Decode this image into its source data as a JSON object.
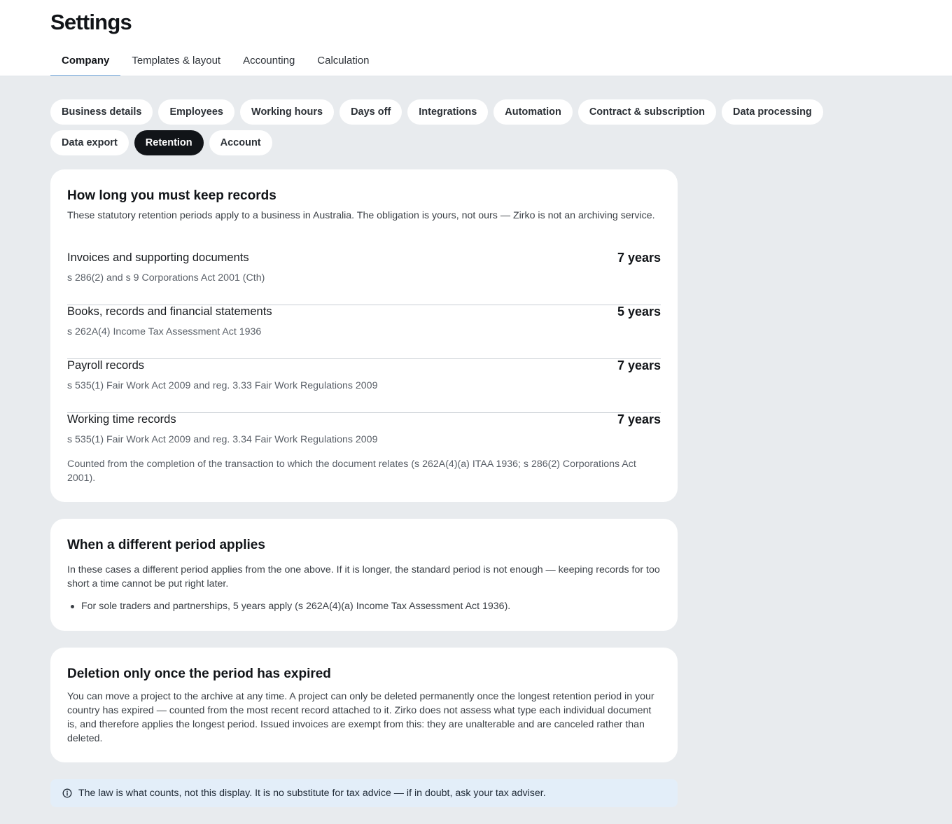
{
  "header": {
    "title": "Settings",
    "tabs": [
      {
        "label": "Company",
        "active": true
      },
      {
        "label": "Templates & layout",
        "active": false
      },
      {
        "label": "Accounting",
        "active": false
      },
      {
        "label": "Calculation",
        "active": false
      }
    ]
  },
  "subnav": {
    "chips": [
      {
        "label": "Business details",
        "active": false
      },
      {
        "label": "Employees",
        "active": false
      },
      {
        "label": "Working hours",
        "active": false
      },
      {
        "label": "Days off",
        "active": false
      },
      {
        "label": "Integrations",
        "active": false
      },
      {
        "label": "Automation",
        "active": false
      },
      {
        "label": "Contract & subscription",
        "active": false
      },
      {
        "label": "Data processing",
        "active": false
      },
      {
        "label": "Data export",
        "active": false
      },
      {
        "label": "Retention",
        "active": true
      },
      {
        "label": "Account",
        "active": false
      }
    ]
  },
  "retention": {
    "title": "How long you must keep records",
    "intro": "These statutory retention periods apply to a business in Australia. The obligation is yours, not ours — Zirko is not an archiving service.",
    "records": [
      {
        "label": "Invoices and supporting documents",
        "value": "7 years",
        "reference": "s 286(2) and s 9 Corporations Act 2001 (Cth)"
      },
      {
        "label": "Books, records and financial statements",
        "value": "5 years",
        "reference": "s 262A(4) Income Tax Assessment Act 1936"
      },
      {
        "label": "Payroll records",
        "value": "7 years",
        "reference": "s 535(1) Fair Work Act 2009 and reg. 3.33 Fair Work Regulations 2009"
      },
      {
        "label": "Working time records",
        "value": "7 years",
        "reference": "s 535(1) Fair Work Act 2009 and reg. 3.34 Fair Work Regulations 2009"
      }
    ],
    "footnote": "Counted from the completion of the transaction to which the document relates (s 262A(4)(a) ITAA 1936; s 286(2) Corporations Act 2001)."
  },
  "different_period": {
    "title": "When a different period applies",
    "body": "In these cases a different period applies from the one above. If it is longer, the standard period is not enough — keeping records for too short a time cannot be put right later.",
    "bullets": [
      "For sole traders and partnerships, 5 years apply (s 262A(4)(a) Income Tax Assessment Act 1936)."
    ]
  },
  "deletion": {
    "title": "Deletion only once the period has expired",
    "body": "You can move a project to the archive at any time. A project can only be deleted permanently once the longest retention period in your country has expired — counted from the most recent record attached to it. Zirko does not assess what type each individual document is, and therefore applies the longest period. Issued invoices are exempt from this: they are unalterable and are canceled rather than deleted."
  },
  "notice": {
    "icon": "info-icon",
    "text": "The law is what counts, not this display. It is no substitute for tax advice — if in doubt, ask your tax adviser."
  },
  "colors": {
    "background": "#e8ebee",
    "active_chip": "#111418",
    "tab_underline": "#7fb0e0",
    "notice_bg": "#e3eef9"
  }
}
